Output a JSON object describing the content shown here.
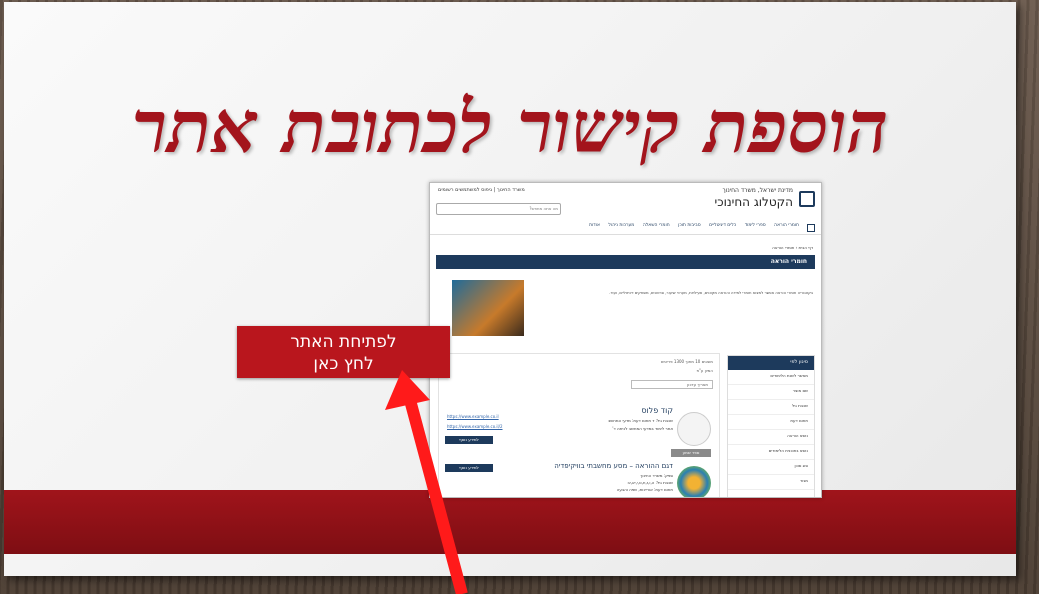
{
  "slide": {
    "title": "הוספת קישור לכתובת אתר"
  },
  "callout": {
    "line1": "לפתיחת האתר",
    "line2": "לחץ כאן"
  },
  "site": {
    "ministry": "מדינת ישראל, משרד החינוך",
    "title": "הקטלוג החינוכי",
    "search_placeholder": "מה אתה מחפש?",
    "logos_label": "משרד החינוך | גיפוס למשתמשים רשומים",
    "nav": [
      "חומרי הוראה",
      "ספרי לימוד",
      "כלים דיגיטליים",
      "סביבות תוכן",
      "חומרי השאלה",
      "מערכות ניהול",
      "אודות"
    ],
    "breadcrumb": "דף הבית › חומרי הוראה",
    "banner": "חומרי הוראה",
    "intro": "בקטגוריה חומרי הוראה אפשר למצוא חומרי למידה והוראה מקוונים, פעילויות, מערכי שיעור, סרטונים, משחקים דיגיטליים, ועוד.",
    "sidebar_head": "סינון לפי",
    "sidebar_items": [
      "מאשר לשנת הלימודים",
      "שם מוצר",
      "שכבת גיל",
      "תחום דעת",
      "נושא הוראה",
      "נושא בתוכנית הלימודים",
      "סוג סוכן",
      "מגזר"
    ],
    "results_meta": "מוצגים 10 מתוך 1300 פריטים",
    "sort_label": "המיון ע\"פ",
    "sort_value": "תאריך עדכון",
    "items": [
      {
        "title": "קוד פלוס",
        "line1": "שכבת גיל: ד תחום דעת: מדעי המחשב",
        "line2": "אתר לימוד במדעי המחשב לכיתה ד'",
        "more": "למידע נוסף",
        "gray": "ספר שמע",
        "link1": "https://www.example.co.il",
        "link2": "https://www.example.co.il/2"
      },
      {
        "title": "דגם ההוראה – מסע מחשבתי בוויקיפדיה",
        "line1": "ספק: משרד החינוך",
        "line2": "שכבת גיל: ה,ו,ז,ח,ט,י,יא,יב",
        "line3": "תחום דעת: אוריינות, שפה והבעה",
        "more": "למידע נוסף"
      }
    ]
  }
}
